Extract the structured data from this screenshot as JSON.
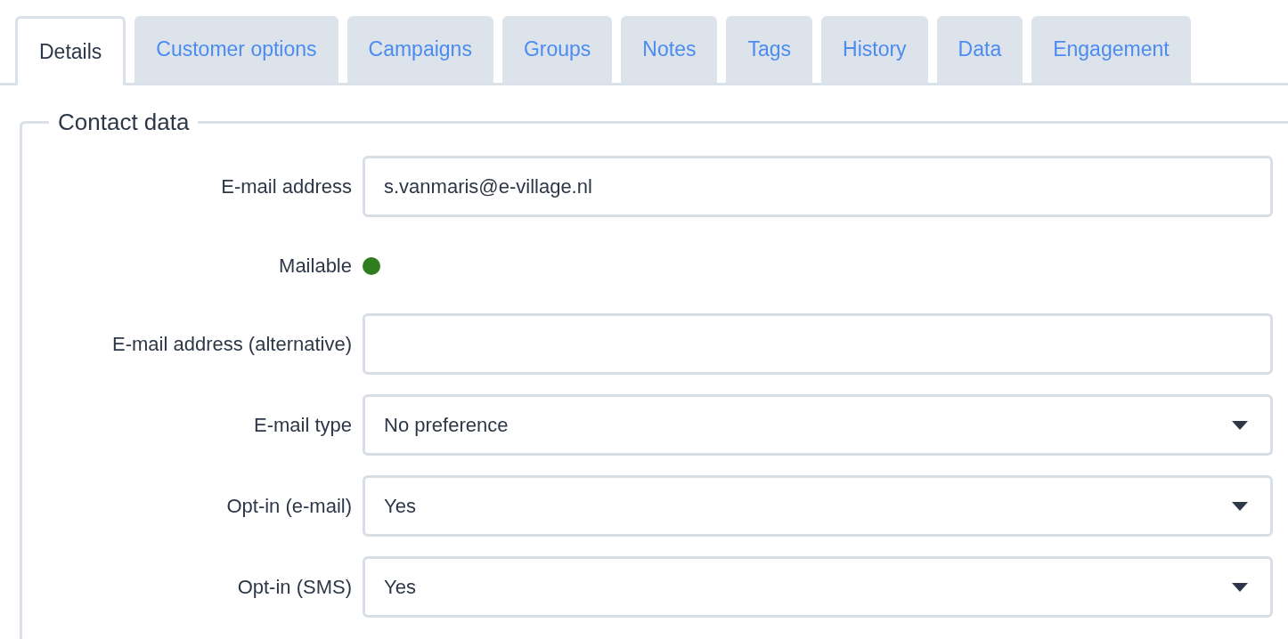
{
  "tabs": [
    {
      "label": "Details",
      "selected": true
    },
    {
      "label": "Customer options",
      "selected": false
    },
    {
      "label": "Campaigns",
      "selected": false
    },
    {
      "label": "Groups",
      "selected": false
    },
    {
      "label": "Notes",
      "selected": false
    },
    {
      "label": "Tags",
      "selected": false
    },
    {
      "label": "History",
      "selected": false
    },
    {
      "label": "Data",
      "selected": false
    },
    {
      "label": "Engagement",
      "selected": false
    }
  ],
  "section": {
    "title": "Contact data",
    "fields": [
      {
        "kind": "text",
        "label": "E-mail address",
        "value": "s.vanmaris@e-village.nl"
      },
      {
        "kind": "status",
        "label": "Mailable",
        "color": "#2e7d1f"
      },
      {
        "kind": "text",
        "label": "E-mail address (alternative)"
      },
      {
        "kind": "select",
        "label": "E-mail type",
        "value": "No preference"
      },
      {
        "kind": "select",
        "label": "Opt-in (e-mail)",
        "value": "Yes"
      },
      {
        "kind": "select",
        "label": "Opt-in (SMS)",
        "value": "Yes"
      }
    ]
  }
}
